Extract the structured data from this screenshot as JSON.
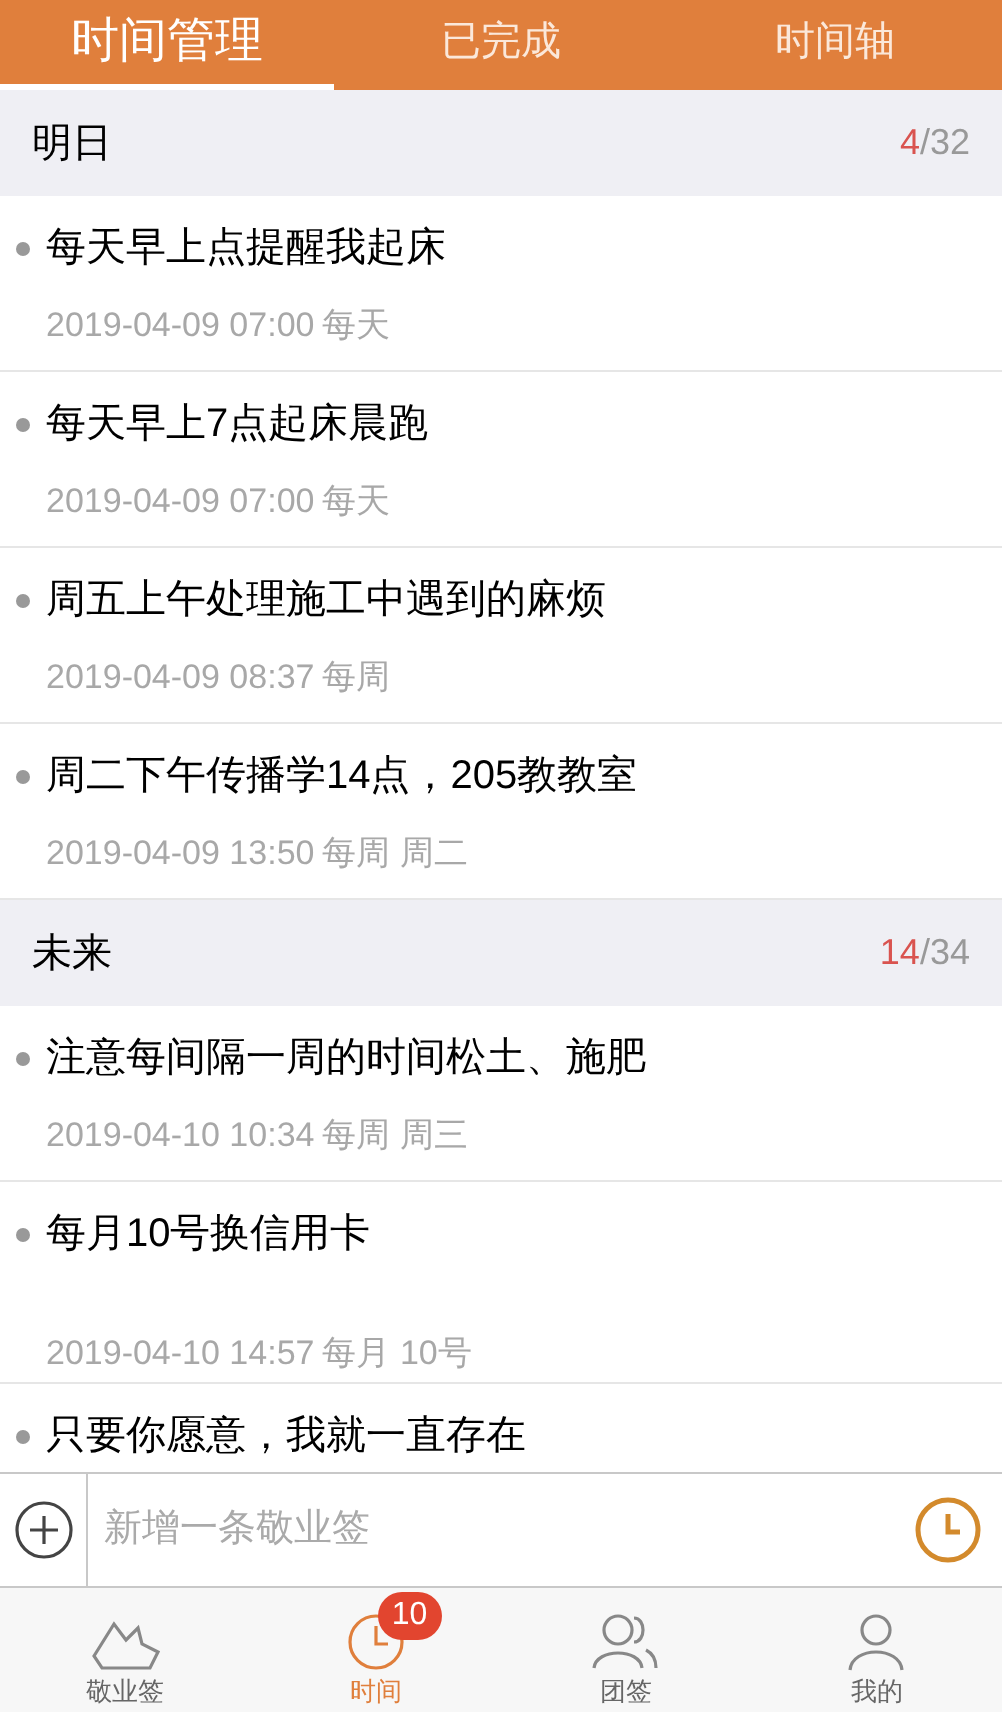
{
  "tabs": [
    {
      "label": "时间管理",
      "selected": true
    },
    {
      "label": "已完成",
      "selected": false
    },
    {
      "label": "时间轴",
      "selected": false
    }
  ],
  "sections": [
    {
      "title": "明日",
      "done": "4",
      "slash": "/",
      "total": "32",
      "items": [
        {
          "title": "每天早上点提醒我起床",
          "time": "2019-04-09 07:00",
          "repeat": "每天",
          "extra_space": false
        },
        {
          "title": "每天早上7点起床晨跑",
          "time": "2019-04-09 07:00",
          "repeat": "每天",
          "extra_space": false
        },
        {
          "title": "周五上午处理施工中遇到的麻烦",
          "time": "2019-04-09 08:37",
          "repeat": "每周",
          "extra_space": false
        },
        {
          "title": "周二下午传播学14点，205教教室",
          "time": "2019-04-09 13:50",
          "repeat": "每周 周二",
          "extra_space": false
        }
      ]
    },
    {
      "title": "未来",
      "done": "14",
      "slash": "/",
      "total": "34",
      "items": [
        {
          "title": "注意每间隔一周的时间松土、施肥",
          "time": "2019-04-10 10:34",
          "repeat": "每周 周三",
          "extra_space": false
        },
        {
          "title": "每月10号换信用卡",
          "time": "2019-04-10 14:57",
          "repeat": "每月 10号",
          "extra_space": true
        },
        {
          "title": "只要你愿意，我就一直存在",
          "extra_space": false
        }
      ]
    }
  ],
  "composer": {
    "placeholder": "新增一条敬业签"
  },
  "nav": [
    {
      "kind": "notes",
      "label": "敬业签",
      "selected": false
    },
    {
      "kind": "time",
      "label": "时间",
      "selected": true,
      "badge": "10"
    },
    {
      "kind": "team",
      "label": "团签",
      "selected": false
    },
    {
      "kind": "me",
      "label": "我的",
      "selected": false
    }
  ]
}
